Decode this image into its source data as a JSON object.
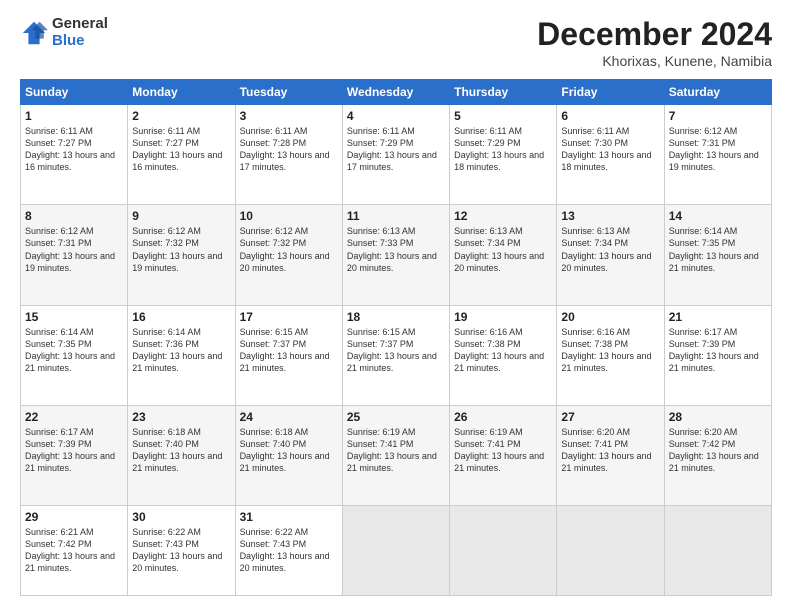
{
  "logo": {
    "general": "General",
    "blue": "Blue"
  },
  "title": "December 2024",
  "location": "Khorixas, Kunene, Namibia",
  "weekdays": [
    "Sunday",
    "Monday",
    "Tuesday",
    "Wednesday",
    "Thursday",
    "Friday",
    "Saturday"
  ],
  "weeks": [
    [
      {
        "day": "1",
        "sunrise": "6:11 AM",
        "sunset": "7:27 PM",
        "daylight": "13 hours and 16 minutes."
      },
      {
        "day": "2",
        "sunrise": "6:11 AM",
        "sunset": "7:27 PM",
        "daylight": "13 hours and 16 minutes."
      },
      {
        "day": "3",
        "sunrise": "6:11 AM",
        "sunset": "7:28 PM",
        "daylight": "13 hours and 17 minutes."
      },
      {
        "day": "4",
        "sunrise": "6:11 AM",
        "sunset": "7:29 PM",
        "daylight": "13 hours and 17 minutes."
      },
      {
        "day": "5",
        "sunrise": "6:11 AM",
        "sunset": "7:29 PM",
        "daylight": "13 hours and 18 minutes."
      },
      {
        "day": "6",
        "sunrise": "6:11 AM",
        "sunset": "7:30 PM",
        "daylight": "13 hours and 18 minutes."
      },
      {
        "day": "7",
        "sunrise": "6:12 AM",
        "sunset": "7:31 PM",
        "daylight": "13 hours and 19 minutes."
      }
    ],
    [
      {
        "day": "8",
        "sunrise": "6:12 AM",
        "sunset": "7:31 PM",
        "daylight": "13 hours and 19 minutes."
      },
      {
        "day": "9",
        "sunrise": "6:12 AM",
        "sunset": "7:32 PM",
        "daylight": "13 hours and 19 minutes."
      },
      {
        "day": "10",
        "sunrise": "6:12 AM",
        "sunset": "7:32 PM",
        "daylight": "13 hours and 20 minutes."
      },
      {
        "day": "11",
        "sunrise": "6:13 AM",
        "sunset": "7:33 PM",
        "daylight": "13 hours and 20 minutes."
      },
      {
        "day": "12",
        "sunrise": "6:13 AM",
        "sunset": "7:34 PM",
        "daylight": "13 hours and 20 minutes."
      },
      {
        "day": "13",
        "sunrise": "6:13 AM",
        "sunset": "7:34 PM",
        "daylight": "13 hours and 20 minutes."
      },
      {
        "day": "14",
        "sunrise": "6:14 AM",
        "sunset": "7:35 PM",
        "daylight": "13 hours and 21 minutes."
      }
    ],
    [
      {
        "day": "15",
        "sunrise": "6:14 AM",
        "sunset": "7:35 PM",
        "daylight": "13 hours and 21 minutes."
      },
      {
        "day": "16",
        "sunrise": "6:14 AM",
        "sunset": "7:36 PM",
        "daylight": "13 hours and 21 minutes."
      },
      {
        "day": "17",
        "sunrise": "6:15 AM",
        "sunset": "7:37 PM",
        "daylight": "13 hours and 21 minutes."
      },
      {
        "day": "18",
        "sunrise": "6:15 AM",
        "sunset": "7:37 PM",
        "daylight": "13 hours and 21 minutes."
      },
      {
        "day": "19",
        "sunrise": "6:16 AM",
        "sunset": "7:38 PM",
        "daylight": "13 hours and 21 minutes."
      },
      {
        "day": "20",
        "sunrise": "6:16 AM",
        "sunset": "7:38 PM",
        "daylight": "13 hours and 21 minutes."
      },
      {
        "day": "21",
        "sunrise": "6:17 AM",
        "sunset": "7:39 PM",
        "daylight": "13 hours and 21 minutes."
      }
    ],
    [
      {
        "day": "22",
        "sunrise": "6:17 AM",
        "sunset": "7:39 PM",
        "daylight": "13 hours and 21 minutes."
      },
      {
        "day": "23",
        "sunrise": "6:18 AM",
        "sunset": "7:40 PM",
        "daylight": "13 hours and 21 minutes."
      },
      {
        "day": "24",
        "sunrise": "6:18 AM",
        "sunset": "7:40 PM",
        "daylight": "13 hours and 21 minutes."
      },
      {
        "day": "25",
        "sunrise": "6:19 AM",
        "sunset": "7:41 PM",
        "daylight": "13 hours and 21 minutes."
      },
      {
        "day": "26",
        "sunrise": "6:19 AM",
        "sunset": "7:41 PM",
        "daylight": "13 hours and 21 minutes."
      },
      {
        "day": "27",
        "sunrise": "6:20 AM",
        "sunset": "7:41 PM",
        "daylight": "13 hours and 21 minutes."
      },
      {
        "day": "28",
        "sunrise": "6:20 AM",
        "sunset": "7:42 PM",
        "daylight": "13 hours and 21 minutes."
      }
    ],
    [
      {
        "day": "29",
        "sunrise": "6:21 AM",
        "sunset": "7:42 PM",
        "daylight": "13 hours and 21 minutes."
      },
      {
        "day": "30",
        "sunrise": "6:22 AM",
        "sunset": "7:43 PM",
        "daylight": "13 hours and 20 minutes."
      },
      {
        "day": "31",
        "sunrise": "6:22 AM",
        "sunset": "7:43 PM",
        "daylight": "13 hours and 20 minutes."
      },
      null,
      null,
      null,
      null
    ]
  ]
}
